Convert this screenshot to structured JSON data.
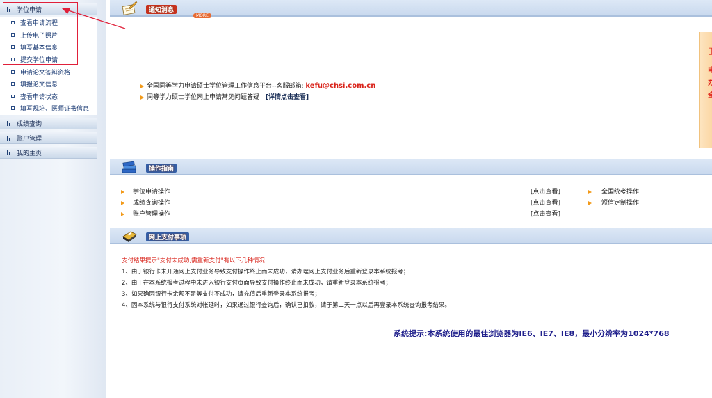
{
  "sidebar": {
    "menus": [
      {
        "label": "学位申请"
      },
      {
        "label": "成绩查询"
      },
      {
        "label": "账户管理"
      },
      {
        "label": "我的主页"
      }
    ],
    "sub_items": [
      {
        "label": "查看申请流程"
      },
      {
        "label": "上传电子照片"
      },
      {
        "label": "填写基本信息"
      },
      {
        "label": "提交学位申请"
      },
      {
        "label": "申请论文答辩资格"
      },
      {
        "label": "填报论文信息"
      },
      {
        "label": "查看申请状态"
      },
      {
        "label": "填写规培、医师证书信息"
      }
    ]
  },
  "notice": {
    "title": "通知消息",
    "more": "MORE",
    "line1": "全国同等学力申请硕士学位管理工作信息平台--客服邮箱:",
    "email": "kefu@chsi.com.cn",
    "line2": "同等学力硕士学位网上申请常见问题答疑",
    "line2_link": "[详情点击查看]"
  },
  "guide": {
    "title": "操作指南",
    "items": [
      {
        "label": "学位申请操作",
        "link": "[点击查看]"
      },
      {
        "label": "成绩查询操作",
        "link": "[点击查看]"
      },
      {
        "label": "账户管理操作",
        "link": "[点击查看]"
      }
    ],
    "right_items": [
      {
        "label": "全国统考操作"
      },
      {
        "label": "短信定制操作"
      }
    ]
  },
  "pay": {
    "title": "网上支付事项",
    "intro": "支付结果提示\"支付未成功,需重新支付\"有以下几种情况:",
    "lines": [
      "1、由于银行卡未开通网上支付业务导致支付操作终止而未成功，请办理网上支付业务后重新登录本系统报考；",
      "2、由于在本系统报考过程中未进入银行支付页面导致支付操作终止而未成功，请重新登录本系统报考；",
      "3、如果确因银行卡余额不足等支付不成功，请充值后重新登录本系统报考；",
      "4、因本系统与银行支付系统对帐延时，如果通过银行查询后，确认已扣款，请于第二天十点以后再登录本系统查询报考结果。"
    ]
  },
  "system_tip": "系统提示:本系统使用的最佳浏览器为IE6、IE7、IE8，最小分辨率为1024*768",
  "banner_chars": [
    "申",
    "办",
    "全"
  ],
  "colors": {
    "accent_red": "#d9241b",
    "nav_blue": "#1a2e56",
    "annotation_red": "#e0203a"
  }
}
